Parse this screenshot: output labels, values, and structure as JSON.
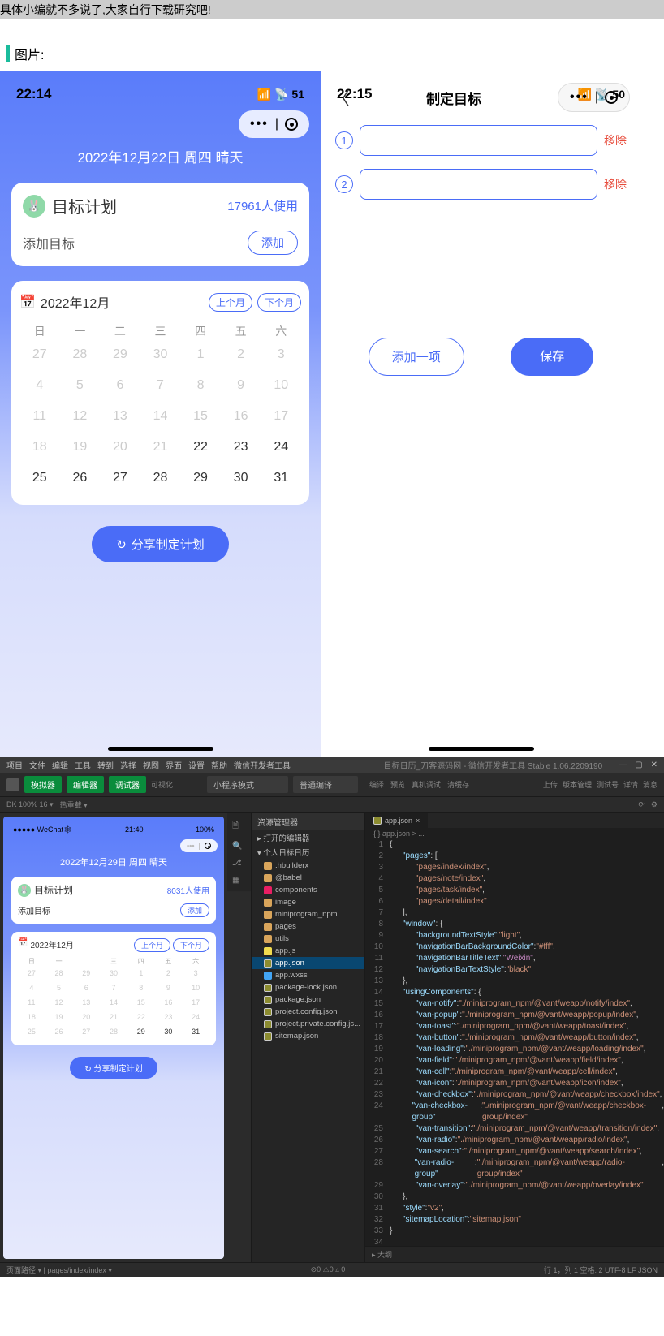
{
  "intro_text": "具体小编就不多说了,大家自行下载研究吧!",
  "section_label": "图片:",
  "left": {
    "time": "22:14",
    "battery": "51",
    "date_line": "2022年12月22日 周四 晴天",
    "plan_title": "目标计划",
    "usage": "17961人使用",
    "add_target": "添加目标",
    "add_btn": "添加",
    "cal_title": "2022年12月",
    "prev_month": "上个月",
    "next_month": "下个月",
    "weekdays": [
      "日",
      "一",
      "二",
      "三",
      "四",
      "五",
      "六"
    ],
    "days": [
      {
        "d": "27"
      },
      {
        "d": "28"
      },
      {
        "d": "29"
      },
      {
        "d": "30"
      },
      {
        "d": "1"
      },
      {
        "d": "2"
      },
      {
        "d": "3"
      },
      {
        "d": "4"
      },
      {
        "d": "5"
      },
      {
        "d": "6"
      },
      {
        "d": "7"
      },
      {
        "d": "8"
      },
      {
        "d": "9"
      },
      {
        "d": "10"
      },
      {
        "d": "11"
      },
      {
        "d": "12"
      },
      {
        "d": "13"
      },
      {
        "d": "14"
      },
      {
        "d": "15"
      },
      {
        "d": "16"
      },
      {
        "d": "17"
      },
      {
        "d": "18"
      },
      {
        "d": "19"
      },
      {
        "d": "20"
      },
      {
        "d": "21"
      },
      {
        "d": "22",
        "a": 1
      },
      {
        "d": "23",
        "a": 1
      },
      {
        "d": "24",
        "a": 1
      },
      {
        "d": "25",
        "a": 1
      },
      {
        "d": "26",
        "a": 1
      },
      {
        "d": "27",
        "a": 1
      },
      {
        "d": "28",
        "a": 1
      },
      {
        "d": "29",
        "a": 1
      },
      {
        "d": "30",
        "a": 1
      },
      {
        "d": "31",
        "a": 1
      }
    ],
    "share_btn": "分享制定计划"
  },
  "right": {
    "time": "22:15",
    "battery": "50",
    "title": "制定目标",
    "remove": "移除",
    "rows": [
      "1",
      "2"
    ],
    "add_one": "添加一项",
    "save": "保存"
  },
  "ide": {
    "menu": [
      "项目",
      "文件",
      "编辑",
      "工具",
      "转到",
      "选择",
      "视图",
      "界面",
      "设置",
      "帮助",
      "微信开发者工具"
    ],
    "title": "目标日历_刀客源码网 - 微信开发者工具 Stable 1.06.2209190",
    "top_buttons": {
      "sim": "模拟器",
      "ed": "编辑器",
      "dbg": "调试器",
      "vis": "可视化"
    },
    "mode": "小程序模式",
    "compile": "普通编译",
    "actions": [
      "编译",
      "预览",
      "真机调试",
      "清缓存"
    ],
    "right_actions": [
      "上传",
      "版本管理",
      "测试号",
      "详情",
      "消息"
    ],
    "zoom": "DK 100% 16 ▾",
    "back_label": "热重载 ▾",
    "sim": {
      "carrier": "●●●●● WeChat🕸",
      "time": "21:40",
      "battery": "100%",
      "date_line": "2022年12月29日 周四 晴天",
      "plan_title": "目标计划",
      "usage": "8031人使用",
      "add_target": "添加目标",
      "add_btn": "添加",
      "cal_title": "2022年12月",
      "prev": "上个月",
      "next": "下个月",
      "weekdays": [
        "日",
        "一",
        "二",
        "三",
        "四",
        "五",
        "六"
      ],
      "days": [
        {
          "d": "27"
        },
        {
          "d": "28"
        },
        {
          "d": "29"
        },
        {
          "d": "30"
        },
        {
          "d": "1"
        },
        {
          "d": "2"
        },
        {
          "d": "3"
        },
        {
          "d": "4"
        },
        {
          "d": "5"
        },
        {
          "d": "6"
        },
        {
          "d": "7"
        },
        {
          "d": "8"
        },
        {
          "d": "9"
        },
        {
          "d": "10"
        },
        {
          "d": "11"
        },
        {
          "d": "12"
        },
        {
          "d": "13"
        },
        {
          "d": "14"
        },
        {
          "d": "15"
        },
        {
          "d": "16"
        },
        {
          "d": "17"
        },
        {
          "d": "18"
        },
        {
          "d": "19"
        },
        {
          "d": "20"
        },
        {
          "d": "21"
        },
        {
          "d": "22"
        },
        {
          "d": "23"
        },
        {
          "d": "24"
        },
        {
          "d": "25"
        },
        {
          "d": "26"
        },
        {
          "d": "27"
        },
        {
          "d": "28"
        },
        {
          "d": "29",
          "a": 1
        },
        {
          "d": "30",
          "a": 1
        },
        {
          "d": "31",
          "a": 1
        }
      ],
      "share": "分享制定计划"
    },
    "explorer_head": "资源管理器",
    "tree": [
      {
        "t": "▸ 打开的编辑器",
        "d": 0,
        "ic": ""
      },
      {
        "t": "▾ 个人日标日历",
        "d": 0,
        "ic": ""
      },
      {
        "t": ".hbuilderx",
        "d": 1,
        "ic": "ic-folder"
      },
      {
        "t": "@babel",
        "d": 1,
        "ic": "ic-folder"
      },
      {
        "t": "components",
        "d": 1,
        "ic": "ic-comp"
      },
      {
        "t": "image",
        "d": 1,
        "ic": "ic-folder"
      },
      {
        "t": "miniprogram_npm",
        "d": 1,
        "ic": "ic-folder"
      },
      {
        "t": "pages",
        "d": 1,
        "ic": "ic-folder"
      },
      {
        "t": "utils",
        "d": 1,
        "ic": "ic-folder"
      },
      {
        "t": "app.js",
        "d": 1,
        "ic": "ic-js"
      },
      {
        "t": "app.json",
        "d": 1,
        "ic": "ic-json",
        "sel": 1
      },
      {
        "t": "app.wxss",
        "d": 1,
        "ic": "ic-css"
      },
      {
        "t": "package-lock.json",
        "d": 1,
        "ic": "ic-json"
      },
      {
        "t": "package.json",
        "d": 1,
        "ic": "ic-json"
      },
      {
        "t": "project.config.json",
        "d": 1,
        "ic": "ic-json"
      },
      {
        "t": "project.private.config.js...",
        "d": 1,
        "ic": "ic-json"
      },
      {
        "t": "sitemap.json",
        "d": 1,
        "ic": "ic-json"
      }
    ],
    "tab": "app.json",
    "crumb": "{ } app.json > ...",
    "code": [
      {
        "n": 1,
        "i": 0,
        "s": [
          [
            "punc",
            "{"
          ]
        ]
      },
      {
        "n": 2,
        "i": 2,
        "s": [
          [
            "key",
            "\"pages\""
          ],
          [
            "punc",
            ": ["
          ]
        ]
      },
      {
        "n": 3,
        "i": 4,
        "s": [
          [
            "str",
            "\"pages/index/index\""
          ],
          [
            "punc",
            ","
          ]
        ]
      },
      {
        "n": 4,
        "i": 4,
        "s": [
          [
            "str",
            "\"pages/note/index\""
          ],
          [
            "punc",
            ","
          ]
        ]
      },
      {
        "n": 5,
        "i": 4,
        "s": [
          [
            "str",
            "\"pages/task/index\""
          ],
          [
            "punc",
            ","
          ]
        ]
      },
      {
        "n": 6,
        "i": 4,
        "s": [
          [
            "str",
            "\"pages/detail/index\""
          ]
        ]
      },
      {
        "n": 7,
        "i": 2,
        "s": [
          [
            "punc",
            "],"
          ]
        ]
      },
      {
        "n": 8,
        "i": 2,
        "s": [
          [
            "key",
            "\"window\""
          ],
          [
            "punc",
            ": {"
          ]
        ]
      },
      {
        "n": 9,
        "i": 4,
        "s": [
          [
            "key",
            "\"backgroundTextStyle\""
          ],
          [
            "punc",
            ": "
          ],
          [
            "str",
            "\"light\""
          ],
          [
            "punc",
            ","
          ]
        ]
      },
      {
        "n": 10,
        "i": 4,
        "s": [
          [
            "key",
            "\"navigationBarBackgroundColor\""
          ],
          [
            "punc",
            ": "
          ],
          [
            "str",
            "\"#fff\""
          ],
          [
            "punc",
            ","
          ]
        ]
      },
      {
        "n": 11,
        "i": 4,
        "s": [
          [
            "key",
            "\"navigationBarTitleText\""
          ],
          [
            "punc",
            ": "
          ],
          [
            "str2",
            "\"Weixin\""
          ],
          [
            "punc",
            ","
          ]
        ]
      },
      {
        "n": 12,
        "i": 4,
        "s": [
          [
            "key",
            "\"navigationBarTextStyle\""
          ],
          [
            "punc",
            ": "
          ],
          [
            "str",
            "\"black\""
          ]
        ]
      },
      {
        "n": 13,
        "i": 2,
        "s": [
          [
            "punc",
            "},"
          ]
        ]
      },
      {
        "n": 14,
        "i": 2,
        "s": [
          [
            "key",
            "\"usingComponents\""
          ],
          [
            "punc",
            ": {"
          ]
        ]
      },
      {
        "n": 15,
        "i": 4,
        "s": [
          [
            "key",
            "\"van-notify\""
          ],
          [
            "punc",
            ": "
          ],
          [
            "str",
            "\"./miniprogram_npm/@vant/weapp/notify/index\""
          ],
          [
            "punc",
            ","
          ]
        ]
      },
      {
        "n": 16,
        "i": 4,
        "s": [
          [
            "key",
            "\"van-popup\""
          ],
          [
            "punc",
            ": "
          ],
          [
            "str",
            "\"./miniprogram_npm/@vant/weapp/popup/index\""
          ],
          [
            "punc",
            ","
          ]
        ]
      },
      {
        "n": 17,
        "i": 4,
        "s": [
          [
            "key",
            "\"van-toast\""
          ],
          [
            "punc",
            ": "
          ],
          [
            "str",
            "\"./miniprogram_npm/@vant/weapp/toast/index\""
          ],
          [
            "punc",
            ","
          ]
        ]
      },
      {
        "n": 18,
        "i": 4,
        "s": [
          [
            "key",
            "\"van-button\""
          ],
          [
            "punc",
            ": "
          ],
          [
            "str",
            "\"./miniprogram_npm/@vant/weapp/button/index\""
          ],
          [
            "punc",
            ","
          ]
        ]
      },
      {
        "n": 19,
        "i": 4,
        "s": [
          [
            "key",
            "\"van-loading\""
          ],
          [
            "punc",
            ": "
          ],
          [
            "str",
            "\"./miniprogram_npm/@vant/weapp/loading/index\""
          ],
          [
            "punc",
            ","
          ]
        ]
      },
      {
        "n": 20,
        "i": 4,
        "s": [
          [
            "key",
            "\"van-field\""
          ],
          [
            "punc",
            ": "
          ],
          [
            "str",
            "\"./miniprogram_npm/@vant/weapp/field/index\""
          ],
          [
            "punc",
            ","
          ]
        ]
      },
      {
        "n": 21,
        "i": 4,
        "s": [
          [
            "key",
            "\"van-cell\""
          ],
          [
            "punc",
            ": "
          ],
          [
            "str",
            "\"./miniprogram_npm/@vant/weapp/cell/index\""
          ],
          [
            "punc",
            ","
          ]
        ]
      },
      {
        "n": 22,
        "i": 4,
        "s": [
          [
            "key",
            "\"van-icon\""
          ],
          [
            "punc",
            ": "
          ],
          [
            "str",
            "\"./miniprogram_npm/@vant/weapp/icon/index\""
          ],
          [
            "punc",
            ","
          ]
        ]
      },
      {
        "n": 23,
        "i": 4,
        "s": [
          [
            "key",
            "\"van-checkbox\""
          ],
          [
            "punc",
            ": "
          ],
          [
            "str",
            "\"./miniprogram_npm/@vant/weapp/checkbox/index\""
          ],
          [
            "punc",
            ","
          ]
        ]
      },
      {
        "n": 24,
        "i": 4,
        "s": [
          [
            "key",
            "\"van-checkbox-group\""
          ],
          [
            "punc",
            ": "
          ],
          [
            "str",
            "\"./miniprogram_npm/@vant/weapp/checkbox-group/index\""
          ],
          [
            "punc",
            ","
          ]
        ]
      },
      {
        "n": 25,
        "i": 4,
        "s": [
          [
            "key",
            "\"van-transition\""
          ],
          [
            "punc",
            ": "
          ],
          [
            "str",
            "\"./miniprogram_npm/@vant/weapp/transition/index\""
          ],
          [
            "punc",
            ","
          ]
        ]
      },
      {
        "n": 26,
        "i": 4,
        "s": [
          [
            "key",
            "\"van-radio\""
          ],
          [
            "punc",
            ": "
          ],
          [
            "str",
            "\"./miniprogram_npm/@vant/weapp/radio/index\""
          ],
          [
            "punc",
            ","
          ]
        ]
      },
      {
        "n": 27,
        "i": 4,
        "s": [
          [
            "key",
            "\"van-search\""
          ],
          [
            "punc",
            ": "
          ],
          [
            "str",
            "\"./miniprogram_npm/@vant/weapp/search/index\""
          ],
          [
            "punc",
            ","
          ]
        ]
      },
      {
        "n": 28,
        "i": 4,
        "s": [
          [
            "key",
            "\"van-radio-group\""
          ],
          [
            "punc",
            ": "
          ],
          [
            "str",
            "\"./miniprogram_npm/@vant/weapp/radio-group/index\""
          ],
          [
            "punc",
            ","
          ]
        ]
      },
      {
        "n": 29,
        "i": 4,
        "s": [
          [
            "key",
            "\"van-overlay\""
          ],
          [
            "punc",
            ": "
          ],
          [
            "str",
            "\"./miniprogram_npm/@vant/weapp/overlay/index\""
          ]
        ]
      },
      {
        "n": 30,
        "i": 2,
        "s": [
          [
            "punc",
            "},"
          ]
        ]
      },
      {
        "n": 31,
        "i": 2,
        "s": [
          [
            "key",
            "\"style\""
          ],
          [
            "punc",
            ": "
          ],
          [
            "str",
            "\"v2\""
          ],
          [
            "punc",
            ","
          ]
        ]
      },
      {
        "n": 32,
        "i": 2,
        "s": [
          [
            "key",
            "\"sitemapLocation\""
          ],
          [
            "punc",
            ": "
          ],
          [
            "str",
            "\"sitemap.json\""
          ]
        ]
      },
      {
        "n": 33,
        "i": 0,
        "s": [
          [
            "punc",
            "}"
          ]
        ]
      },
      {
        "n": 34,
        "i": 0,
        "s": []
      }
    ],
    "outline": "▸ 大纲",
    "status_left": "页面路径 ▾ | pages/index/index ▾",
    "status_mid": "⊘0 ⚠0 ▵ 0",
    "status_right": "行 1，列 1  空格: 2  UTF-8  LF  JSON"
  }
}
